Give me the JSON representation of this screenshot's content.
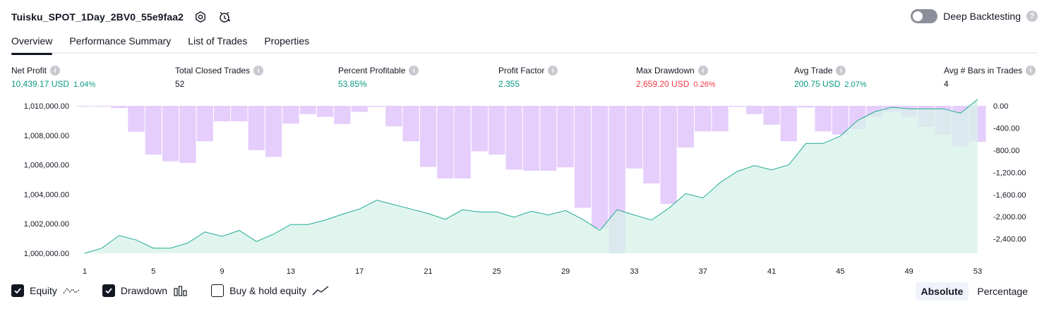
{
  "header": {
    "strategy_name": "Tuisku_SPOT_1Day_2BV0_55e9faa2",
    "deep_backtesting_label": "Deep Backtesting",
    "deep_backtesting_enabled": false
  },
  "tabs": [
    {
      "label": "Overview",
      "active": true
    },
    {
      "label": "Performance Summary",
      "active": false
    },
    {
      "label": "List of Trades",
      "active": false
    },
    {
      "label": "Properties",
      "active": false
    }
  ],
  "metrics": {
    "net_profit": {
      "label": "Net Profit",
      "value": "10,439.17 USD",
      "pct": "1.04%"
    },
    "total_closed_trades": {
      "label": "Total Closed Trades",
      "value": "52"
    },
    "percent_profitable": {
      "label": "Percent Profitable",
      "value": "53.85%"
    },
    "profit_factor": {
      "label": "Profit Factor",
      "value": "2.355"
    },
    "max_drawdown": {
      "label": "Max Drawdown",
      "value": "2,659.20 USD",
      "pct": "0.26%"
    },
    "avg_trade": {
      "label": "Avg Trade",
      "value": "200.75 USD",
      "pct": "2.07%"
    },
    "avg_bars": {
      "label": "Avg # Bars in Trades",
      "value": "4"
    }
  },
  "colors": {
    "equity_line": "#22ab94",
    "equity_fill": "#d7f2ea",
    "drawdown_bar": "#e1c6fb",
    "positive": "#089981",
    "negative": "#f23645"
  },
  "chart_data": {
    "type": "area",
    "x": [
      1,
      2,
      3,
      4,
      5,
      6,
      7,
      8,
      9,
      10,
      11,
      12,
      13,
      14,
      15,
      16,
      17,
      18,
      19,
      20,
      21,
      22,
      23,
      24,
      25,
      26,
      27,
      28,
      29,
      30,
      31,
      32,
      33,
      34,
      35,
      36,
      37,
      38,
      39,
      40,
      41,
      42,
      43,
      44,
      45,
      46,
      47,
      48,
      49,
      50,
      51,
      52,
      53
    ],
    "x_ticks": [
      "1",
      "5",
      "9",
      "13",
      "17",
      "21",
      "25",
      "29",
      "33",
      "37",
      "41",
      "45",
      "49",
      "53"
    ],
    "series": [
      {
        "name": "Equity",
        "axis": "left",
        "values": [
          1000000,
          1000350,
          1001200,
          1000900,
          1000350,
          1000350,
          1000700,
          1001450,
          1001150,
          1001550,
          1000800,
          1001300,
          1001950,
          1001950,
          1002250,
          1002650,
          1003000,
          1003600,
          1003300,
          1003000,
          1002700,
          1002300,
          1002950,
          1002800,
          1002800,
          1002450,
          1002850,
          1002600,
          1002900,
          1002300,
          1001550,
          1002950,
          1002600,
          1002250,
          1003050,
          1004050,
          1003750,
          1004800,
          1005550,
          1005950,
          1005650,
          1006000,
          1007450,
          1007450,
          1007950,
          1009000,
          1009600,
          1009900,
          1009800,
          1009800,
          1009800,
          1009500,
          1010439
        ]
      },
      {
        "name": "Drawdown",
        "axis": "right",
        "values": [
          0,
          0,
          -40,
          -470,
          -880,
          -1000,
          -1030,
          -640,
          -280,
          -280,
          -800,
          -920,
          -320,
          -150,
          -200,
          -330,
          -110,
          -20,
          -370,
          -640,
          -1100,
          -1310,
          -1310,
          -820,
          -880,
          -1150,
          -1170,
          -1170,
          -1110,
          -1840,
          -2210,
          -2659,
          -1130,
          -1400,
          -1770,
          -750,
          -460,
          -460,
          -20,
          -150,
          -340,
          -640,
          -30,
          -460,
          -520,
          -420,
          -200,
          -110,
          -200,
          -380,
          -520,
          -730,
          -650
        ]
      }
    ],
    "left_axis_ticks": [
      "1,010,000.00",
      "1,008,000.00",
      "1,006,000.00",
      "1,004,000.00",
      "1,002,000.00",
      "1,000,000.00"
    ],
    "right_axis_ticks": [
      "0.00",
      "-400.00",
      "-800.00",
      "-1,200.00",
      "-1,600.00",
      "-2,000.00",
      "-2,400.00"
    ],
    "left_ylim": [
      1000000,
      1010000
    ],
    "right_ylim": [
      -2659,
      0
    ]
  },
  "legend": {
    "items": [
      {
        "label": "Equity",
        "checked": true,
        "icon": "equity-line-icon"
      },
      {
        "label": "Drawdown",
        "checked": true,
        "icon": "drawdown-bars-icon"
      },
      {
        "label": "Buy & hold equity",
        "checked": false,
        "icon": "buy-hold-line-icon"
      }
    ]
  },
  "view_mode": {
    "absolute_label": "Absolute",
    "percentage_label": "Percentage",
    "selected": "Absolute"
  }
}
